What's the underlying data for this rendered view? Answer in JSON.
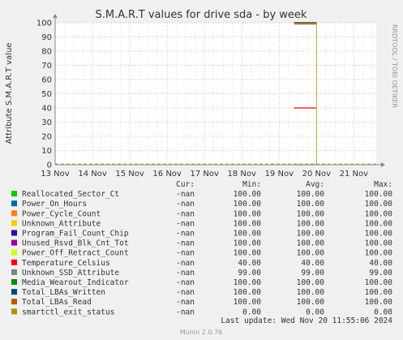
{
  "chart_data": {
    "type": "line",
    "title": "S.M.A.R.T values for drive sda - by week",
    "ylabel": "Attribute S.M.A.R.T value",
    "xlabel": "",
    "ylim": [
      0,
      100
    ],
    "y_ticks": [
      "0",
      "10",
      "20",
      "30",
      "40",
      "50",
      "60",
      "70",
      "80",
      "90",
      "100"
    ],
    "x_ticks": [
      "13 Nov",
      "14 Nov",
      "15 Nov",
      "16 Nov",
      "17 Nov",
      "18 Nov",
      "19 Nov",
      "20 Nov",
      "21 Nov"
    ],
    "x_range": [
      "13 Nov",
      "21.6 Nov"
    ],
    "grid": true,
    "data_window": {
      "start": "19.4 Nov",
      "end": "20.0 Nov"
    },
    "series": [
      {
        "name": "Reallocated_Sector_Ct",
        "color": "#00cc00",
        "value": 100
      },
      {
        "name": "Power_On_Hours",
        "color": "#0066b3",
        "value": 100
      },
      {
        "name": "Power_Cycle_Count",
        "color": "#ff8000",
        "value": 100
      },
      {
        "name": "Unknown_Attribute",
        "color": "#ffcc00",
        "value": 100
      },
      {
        "name": "Program_Fail_Count_Chip",
        "color": "#330099",
        "value": 100
      },
      {
        "name": "Unused_Rsvd_Blk_Cnt_Tot",
        "color": "#990099",
        "value": 100
      },
      {
        "name": "Power_Off_Retract_Count",
        "color": "#ccff00",
        "value": 100
      },
      {
        "name": "Temperature_Celsius",
        "color": "#ff0000",
        "value": 40
      },
      {
        "name": "Unknown_SSD_Attribute",
        "color": "#808080",
        "value": 99
      },
      {
        "name": "Media_Wearout_Indicator",
        "color": "#008f00",
        "value": 100
      },
      {
        "name": "Total_LBAs_Written",
        "color": "#00487d",
        "value": 100
      },
      {
        "name": "Total_LBAs_Read",
        "color": "#b35a00",
        "value": 100
      },
      {
        "name": "smartctl_exit_status",
        "color": "#b38f00",
        "value": 0
      }
    ],
    "legend_header": {
      "cur": "Cur:",
      "min": "Min:",
      "avg": "Avg:",
      "max": "Max:"
    },
    "legend_rows": [
      {
        "cur": "-nan",
        "min": "100.00",
        "avg": "100.00",
        "max": "100.00"
      },
      {
        "cur": "-nan",
        "min": "100.00",
        "avg": "100.00",
        "max": "100.00"
      },
      {
        "cur": "-nan",
        "min": "100.00",
        "avg": "100.00",
        "max": "100.00"
      },
      {
        "cur": "-nan",
        "min": "100.00",
        "avg": "100.00",
        "max": "100.00"
      },
      {
        "cur": "-nan",
        "min": "100.00",
        "avg": "100.00",
        "max": "100.00"
      },
      {
        "cur": "-nan",
        "min": "100.00",
        "avg": "100.00",
        "max": "100.00"
      },
      {
        "cur": "-nan",
        "min": "100.00",
        "avg": "100.00",
        "max": "100.00"
      },
      {
        "cur": "-nan",
        "min": "40.00",
        "avg": "40.00",
        "max": "40.00"
      },
      {
        "cur": "-nan",
        "min": "99.00",
        "avg": "99.00",
        "max": "99.00"
      },
      {
        "cur": "-nan",
        "min": "100.00",
        "avg": "100.00",
        "max": "100.00"
      },
      {
        "cur": "-nan",
        "min": "100.00",
        "avg": "100.00",
        "max": "100.00"
      },
      {
        "cur": "-nan",
        "min": "100.00",
        "avg": "100.00",
        "max": "100.00"
      },
      {
        "cur": "-nan",
        "min": "0.00",
        "avg": "0.00",
        "max": "0.00"
      }
    ],
    "last_update": "Last update:  Wed Nov 20 11:55:06 2024",
    "side_text": "RRDTOOL / TOBI OETIKER",
    "footer": "Munin 2.0.76"
  }
}
